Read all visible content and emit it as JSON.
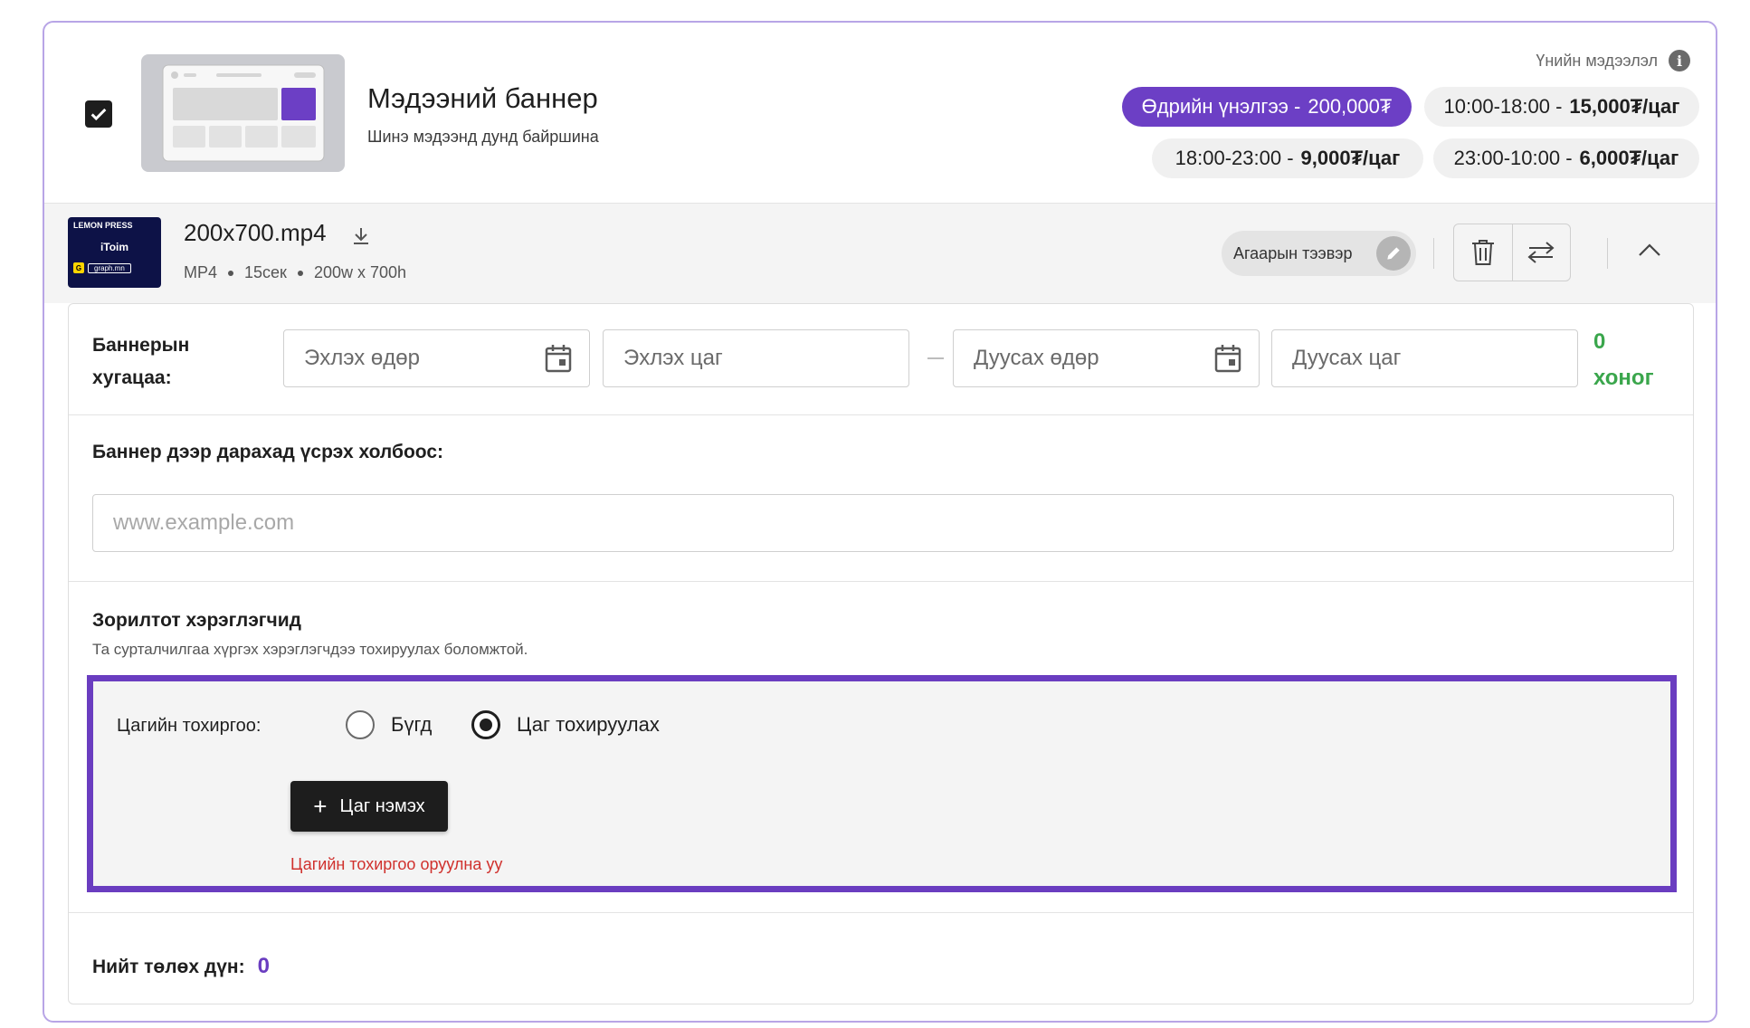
{
  "banner": {
    "checked": true,
    "title": "Мэдээний баннер",
    "subtitle": "Шинэ мэдээнд дунд байршина"
  },
  "pricing": {
    "info_label": "Үнийн мэдээлэл",
    "daily": {
      "label": "Өдрийн үнэлгээ -",
      "value": "200,000₮"
    },
    "slots": [
      {
        "label": "10:00-18:00 -",
        "value": "15,000₮/цаг"
      },
      {
        "label": "18:00-23:00 -",
        "value": "9,000₮/цаг"
      },
      {
        "label": "23:00-10:00 -",
        "value": "6,000₮/цаг"
      }
    ]
  },
  "media": {
    "file_name": "200x700.mp4",
    "format": "MP4",
    "duration": "15сек",
    "dimensions": "200w x 700h",
    "thumb_brand": "LEMON PRESS",
    "thumb_logo": "iToim",
    "thumb_tag": "graph.mn",
    "aircast_label": "Агаарын тээвэр"
  },
  "duration": {
    "label": "Баннерын хугацаа:",
    "start_date_placeholder": "Эхлэх өдөр",
    "start_time_placeholder": "Эхлэх цаг",
    "end_date_placeholder": "Дуусах өдөр",
    "end_time_placeholder": "Дуусах цаг",
    "days_count": "0",
    "days_unit": "хоног"
  },
  "link": {
    "label": "Баннер дээр дарахад үсрэх холбоос:",
    "placeholder": "www.example.com"
  },
  "target": {
    "title": "Зорилтот хэрэглэгчид",
    "description": "Та сурталчилгаа хүргэх хэрэглэгчдээ тохируулах боломжтой.",
    "time_label": "Цагийн тохиргоо:",
    "options": [
      {
        "label": "Бүгд",
        "selected": false
      },
      {
        "label": "Цаг тохируулах",
        "selected": true
      }
    ],
    "add_button": "Цаг нэмэх",
    "error": "Цагийн тохиргоо оруулна уу"
  },
  "total": {
    "label": "Нийт төлөх дүн:",
    "value": "0"
  },
  "colors": {
    "accent": "#6c3fc5",
    "success": "#3aa64c",
    "error": "#d0312d"
  }
}
